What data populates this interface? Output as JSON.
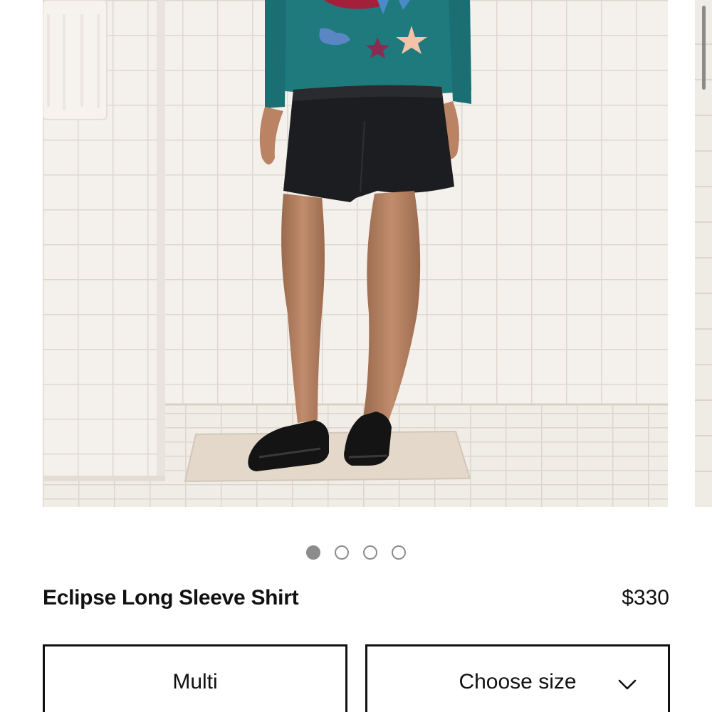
{
  "product": {
    "name": "Eclipse Long Sleeve Shirt",
    "price": "$330"
  },
  "carousel": {
    "image_count": 4,
    "active_index": 0,
    "image_subject": "model-wearing-shirt"
  },
  "options": {
    "color": {
      "value": "Multi"
    },
    "size": {
      "placeholder": "Choose size",
      "icon": "chevron-down-icon"
    }
  },
  "colors": {
    "text": "#111111",
    "dot": "#8c8c8c",
    "shirt": "#1f7a7e",
    "tile": "#f2efe9"
  }
}
